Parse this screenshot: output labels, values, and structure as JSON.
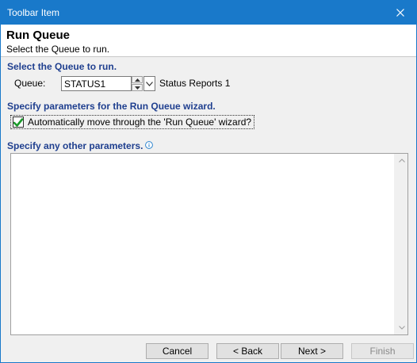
{
  "window": {
    "title": "Toolbar Item",
    "close_icon": "close-icon"
  },
  "header": {
    "title": "Run Queue",
    "subtitle": "Select the Queue to run."
  },
  "queue_section": {
    "heading": "Select the Queue to run.",
    "field_label": "Queue:",
    "value": "STATUS1",
    "description": "Status Reports 1"
  },
  "wizard_section": {
    "heading": "Specify parameters for the Run Queue wizard.",
    "checkbox_label": "Automatically move through the 'Run Queue' wizard?",
    "checked": true
  },
  "other_section": {
    "heading": "Specify any other parameters.",
    "value": ""
  },
  "buttons": {
    "cancel": "Cancel",
    "back": "< Back",
    "next": "Next >",
    "finish": "Finish"
  },
  "colors": {
    "titlebar": "#1979ca",
    "section_heading": "#1f3f8f",
    "check_green": "#1a9a2a"
  }
}
